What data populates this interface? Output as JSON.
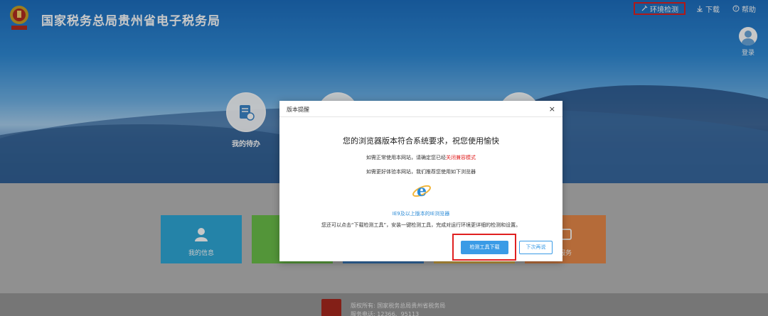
{
  "header": {
    "site_title": "国家税务总局贵州省电子税务局",
    "nav": {
      "env_check": "环境检测",
      "download": "下载",
      "help": "帮助"
    },
    "login_label": "登录"
  },
  "hero": {
    "shortcut_label": "我的待办"
  },
  "tiles": {
    "my_info": "我的信息",
    "service": "服务"
  },
  "footer": {
    "copyright": "版权所有: 国家税务总局贵州省税务局",
    "hotline": "服务电话: 12366、95113"
  },
  "modal": {
    "header_title": "版本提醒",
    "close_symbol": "×",
    "title": "您的浏览器版本符合系统要求，祝您使用愉快",
    "line1_prefix": "如需正常使用本网站，请确定您已经",
    "line1_link": "关闭兼容模式",
    "line2": "如需更好体验本网站，我们推荐您使用如下浏览器",
    "ie_link": "IE9及以上版本的IE浏览器",
    "description": "您还可以点击“下载检测工具”，安装一键检测工具，完成对运行环境更详细的检测和设置。",
    "primary_button": "检测工具下载",
    "secondary_button": "下次再说"
  },
  "colors": {
    "primary": "#3a9be6",
    "highlight": "#e02020",
    "tile_blue": "#2fa8d8",
    "tile_green": "#6bbf4a",
    "tile_orange": "#e88a4a"
  }
}
